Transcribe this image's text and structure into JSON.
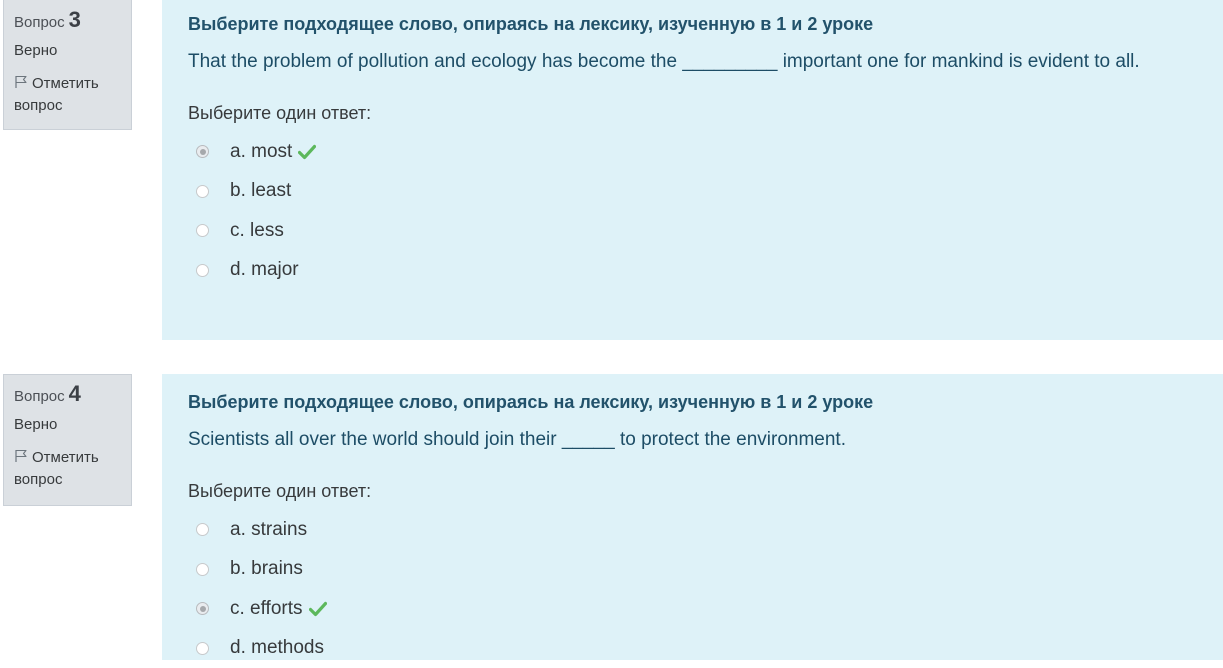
{
  "questions": [
    {
      "label": "Вопрос",
      "number": "3",
      "state": "Верно",
      "flag_label": "Отметить вопрос",
      "instruction": "Выберите подходящее слово, опираясь на лексику, изученную в 1 и 2 уроке",
      "text": "That the problem of pollution and ecology has become the _________ important one for mankind is evident to all.",
      "prompt": "Выберите один ответ:",
      "answers": [
        {
          "label": "a. most",
          "selected": true,
          "correct": true
        },
        {
          "label": "b. least",
          "selected": false,
          "correct": false
        },
        {
          "label": "c. less",
          "selected": false,
          "correct": false
        },
        {
          "label": "d. major",
          "selected": false,
          "correct": false
        }
      ]
    },
    {
      "label": "Вопрос",
      "number": "4",
      "state": "Верно",
      "flag_label": "Отметить вопрос",
      "instruction": "Выберите подходящее слово, опираясь на лексику, изученную в 1 и 2 уроке",
      "text": "Scientists all over the world should join their _____ to protect the environment.",
      "prompt": "Выберите один ответ:",
      "answers": [
        {
          "label": "a. strains",
          "selected": false,
          "correct": false
        },
        {
          "label": "b. brains",
          "selected": false,
          "correct": false
        },
        {
          "label": "c. efforts",
          "selected": true,
          "correct": true
        },
        {
          "label": "d. methods",
          "selected": false,
          "correct": false
        }
      ]
    }
  ],
  "icons": {
    "flag": "flag-icon",
    "correct": "check-icon"
  },
  "colors": {
    "content_bg": "#def2f8",
    "info_bg": "#dee2e6",
    "instruction_text": "#22526b",
    "correct_check": "#5cb85c"
  }
}
